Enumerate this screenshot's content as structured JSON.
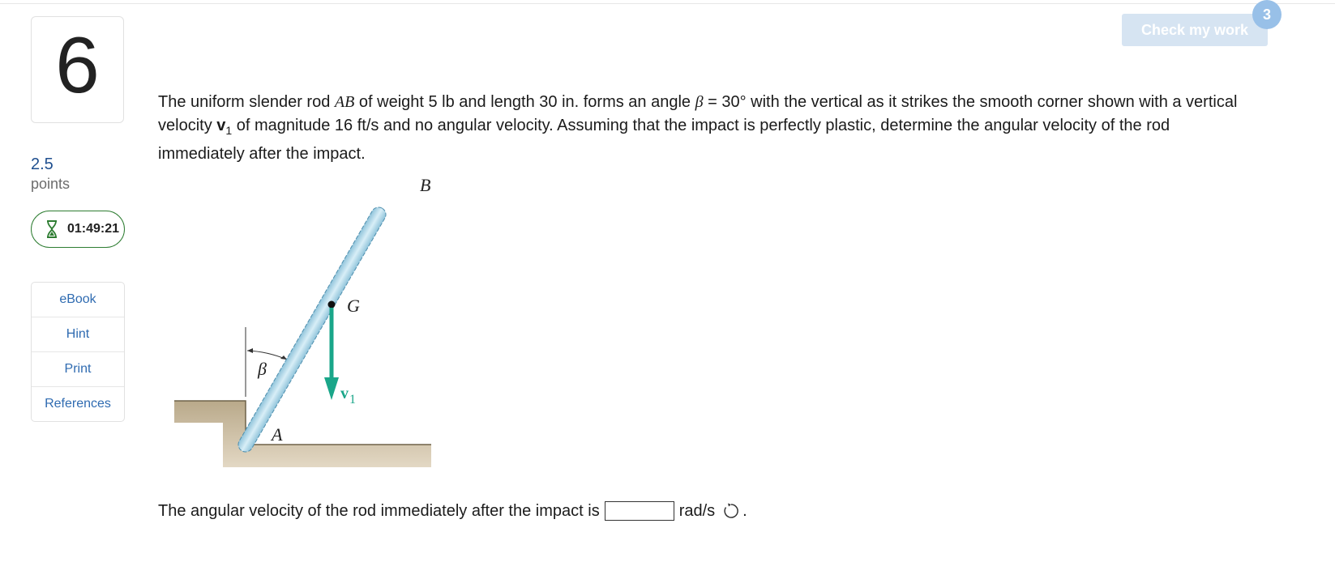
{
  "question": {
    "number": "6",
    "points_value": "2.5",
    "points_label": "points",
    "timer": "01:49:21"
  },
  "tools": [
    {
      "label": "eBook"
    },
    {
      "label": "Hint"
    },
    {
      "label": "Print"
    },
    {
      "label": "References"
    }
  ],
  "header": {
    "check_label": "Check my work",
    "badge_count": "3"
  },
  "problem": {
    "t1": "The uniform slender rod ",
    "rod_name": "AB",
    "t2": " of weight 5 lb and length 30 in. forms an angle ",
    "beta": "β",
    "t3": " = 30° with the vertical as it strikes the smooth corner shown with a vertical velocity ",
    "v": "v",
    "v_sub": "1",
    "t4": " of magnitude 16 ft/s and no angular velocity. Assuming that the impact is perfectly plastic, determine the angular velocity of the rod immediately after the impact."
  },
  "figure": {
    "label_b": "B",
    "label_g": "G",
    "label_beta": "β",
    "label_v": "v",
    "label_v_sub": "1",
    "label_a": "A"
  },
  "answer": {
    "prefix": "The angular velocity of the rod immediately after the impact is",
    "input_value": "",
    "unit": "rad/s",
    "suffix": "."
  },
  "colors": {
    "rod": "#a9d4e6",
    "velocity": "#1aa689",
    "ground": "#c9b99a",
    "timer_border": "#2e7d32",
    "link": "#2f6bb1"
  }
}
